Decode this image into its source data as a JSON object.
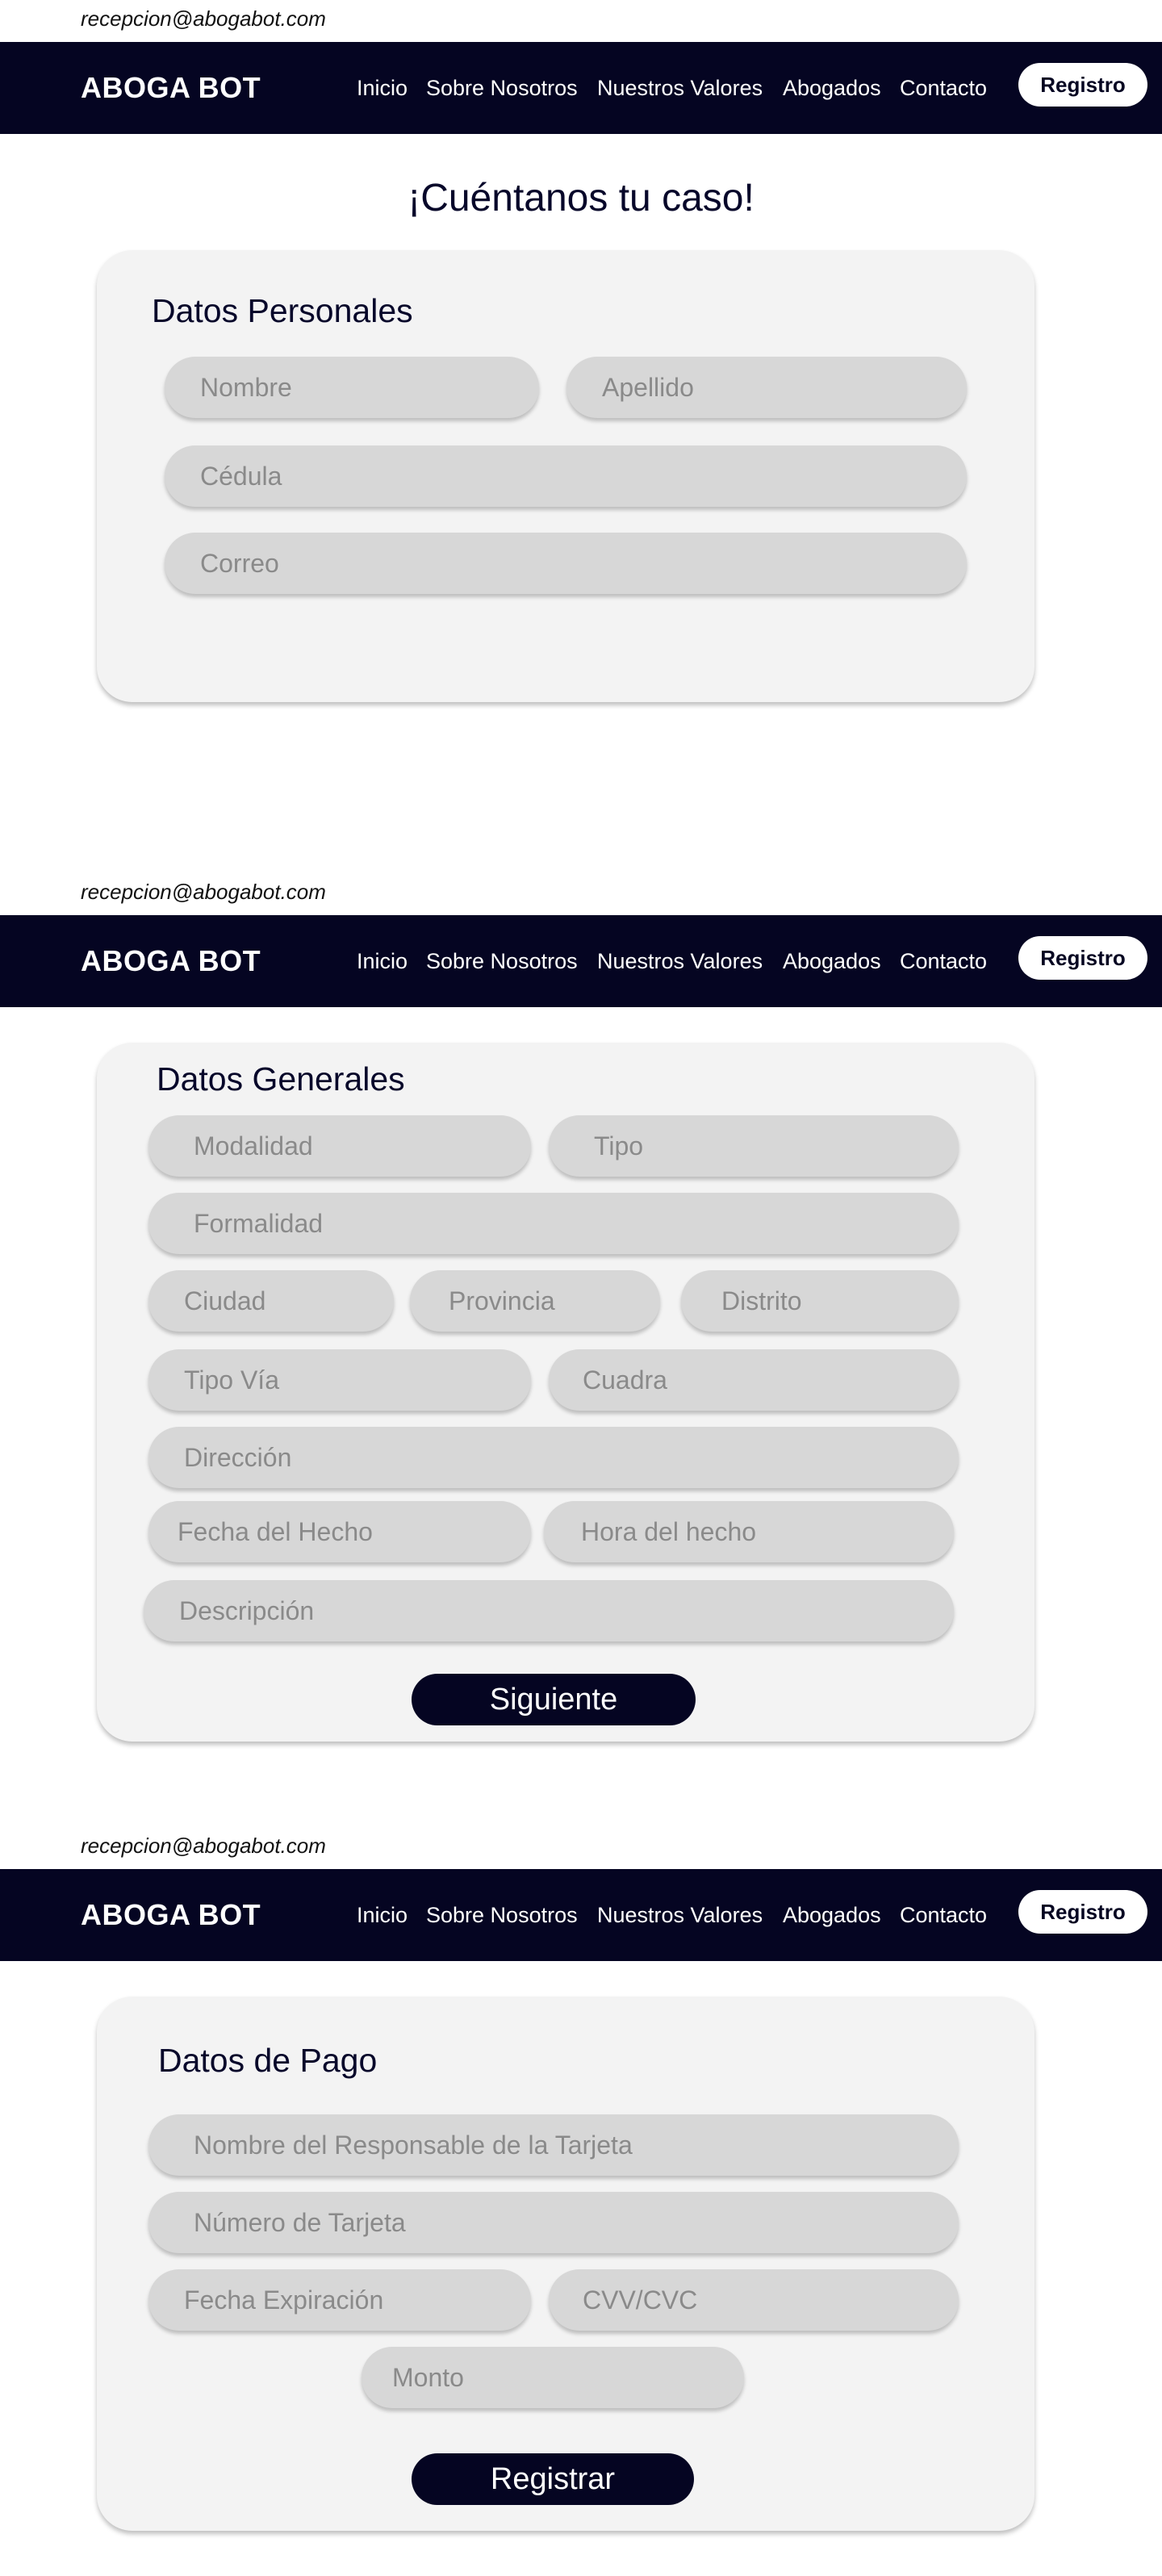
{
  "site": {
    "email": "recepcion@abogabot.com",
    "brand": "ABOGA BOT",
    "nav": [
      "Inicio",
      "Sobre Nosotros",
      "Nuestros Valores",
      "Abogados",
      "Contacto"
    ],
    "register_label": "Registro"
  },
  "step1": {
    "heading": "¡Cuéntanos tu caso!",
    "title": "Datos Personales",
    "fields": {
      "nombre": "Nombre",
      "apellido": "Apellido",
      "cedula": "Cédula",
      "correo": "Correo"
    }
  },
  "step2": {
    "title": "Datos Generales",
    "fields": {
      "modalidad": "Modalidad",
      "tipo": "Tipo",
      "formalidad": "Formalidad",
      "ciudad": "Ciudad",
      "provincia": "Provincia",
      "distrito": "Distrito",
      "tipo_via": "Tipo Vía",
      "cuadra": "Cuadra",
      "direccion": "Dirección",
      "fecha_hecho": "Fecha del Hecho",
      "hora_hecho": "Hora del hecho",
      "descripcion": "Descripción"
    },
    "button": "Siguiente"
  },
  "step3": {
    "title": "Datos de Pago",
    "fields": {
      "responsable": "Nombre del Responsable de la Tarjeta",
      "numero": "Número de Tarjeta",
      "expiracion": "Fecha Expiración",
      "cvv": "CVV/CVC",
      "monto": "Monto"
    },
    "button": "Registrar"
  }
}
